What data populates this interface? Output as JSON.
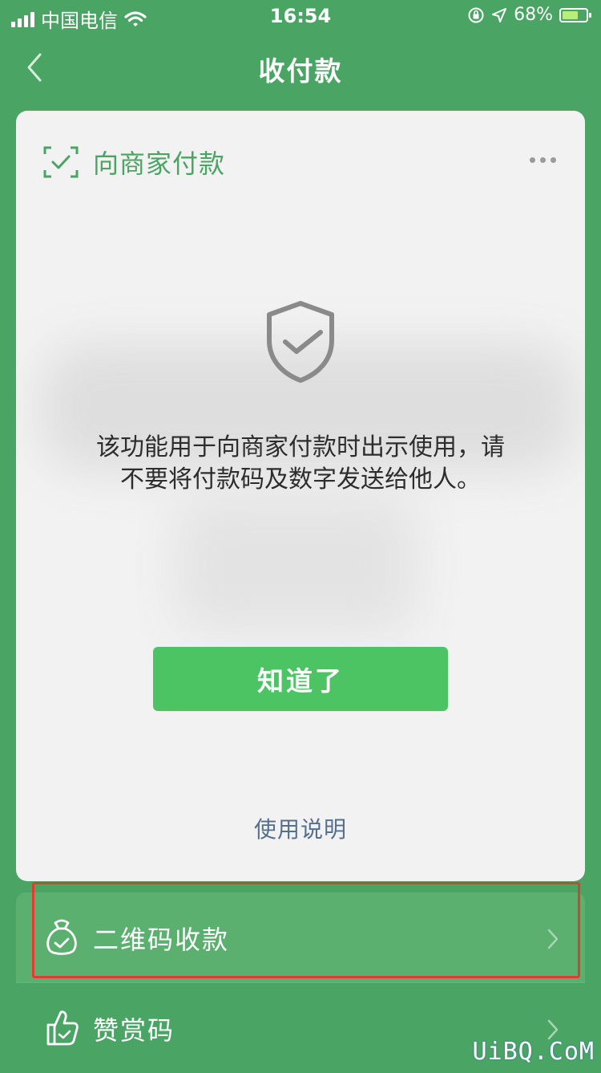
{
  "status_bar": {
    "carrier": "中国电信",
    "time": "16:54",
    "battery_percent": "68%",
    "battery_level": 0.68
  },
  "nav": {
    "title": "收付款",
    "back_icon": "chevron-left-icon"
  },
  "card": {
    "title": "向商家付款",
    "title_icon": "scan-check-icon",
    "more_icon": "more-dots-icon",
    "shield_icon": "shield-check-icon",
    "warning_line1": "该功能用于向商家付款时出示使用，请",
    "warning_line2": "不要将付款码及数字发送给他人。",
    "confirm_label": "知道了",
    "usage_link": "使用说明"
  },
  "menu": {
    "items": [
      {
        "label": "二维码收款",
        "icon": "money-bag-icon"
      },
      {
        "label": "赞赏码",
        "icon": "thumbs-up-icon"
      }
    ]
  },
  "colors": {
    "brand_green": "#4aa463",
    "button_green": "#4dc464",
    "highlight_red": "#e23c32",
    "link_blue": "#55708e"
  },
  "watermark": "UiBQ.CoM"
}
